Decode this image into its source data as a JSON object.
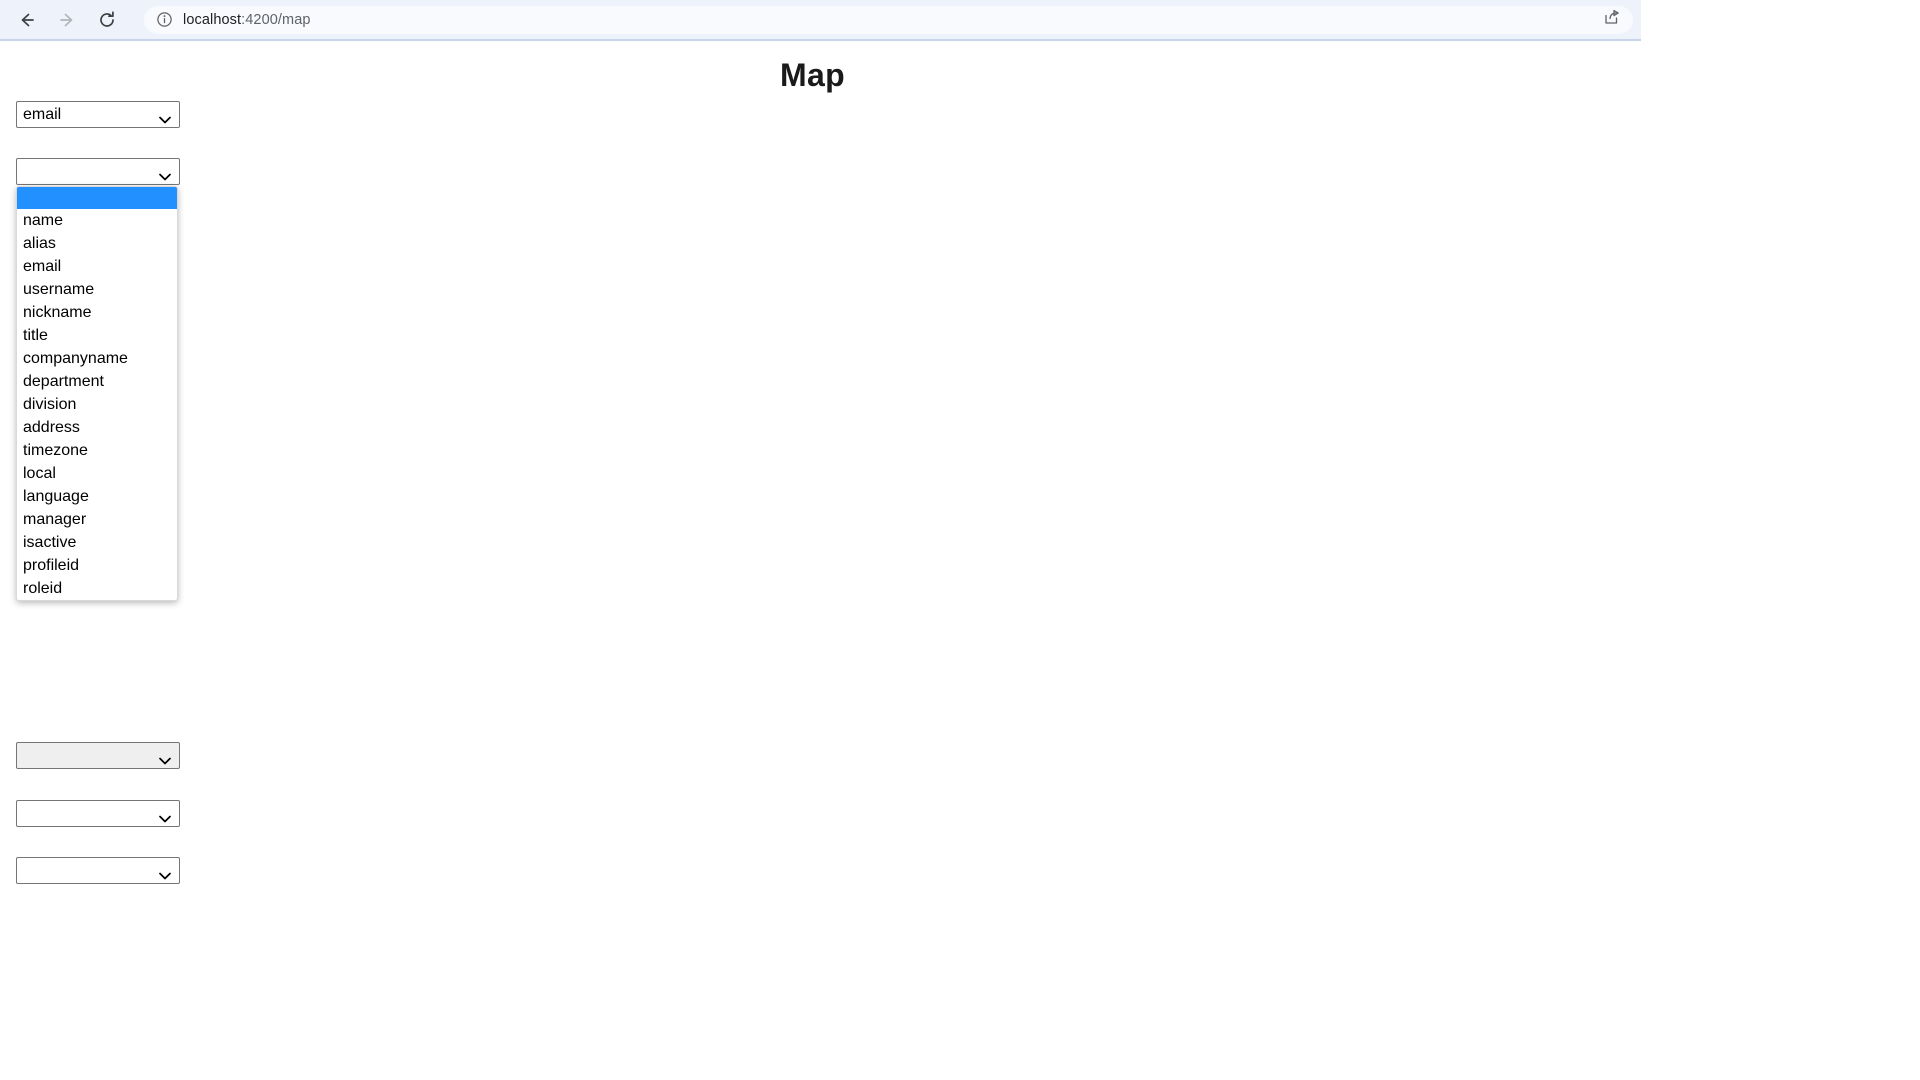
{
  "browser": {
    "back_icon": "back-arrow-icon",
    "forward_icon": "forward-arrow-icon",
    "reload_icon": "reload-icon",
    "site_info_icon": "info-circle-icon",
    "share_icon": "share-icon",
    "url_host": "localhost",
    "url_path": ":4200/map",
    "url_full": "localhost:4200/map"
  },
  "page": {
    "title": "Map"
  },
  "selects": [
    {
      "name": "select-source-field",
      "value": "email"
    },
    {
      "name": "select-target-field",
      "value": ""
    },
    {
      "name": "select-third-field",
      "value": ""
    },
    {
      "name": "select-fourth-field",
      "value": ""
    },
    {
      "name": "select-fifth-field",
      "value": ""
    }
  ],
  "dropdown": {
    "open": true,
    "owner": "select-target-field",
    "highlight_color": "#2291ff",
    "selected_index": 0,
    "options": [
      "",
      "name",
      "alias",
      "email",
      "username",
      "nickname",
      "title",
      "companyname",
      "department",
      "division",
      "address",
      "timezone",
      "local",
      "language",
      "manager",
      "isactive",
      "profileid",
      "roleid"
    ]
  }
}
